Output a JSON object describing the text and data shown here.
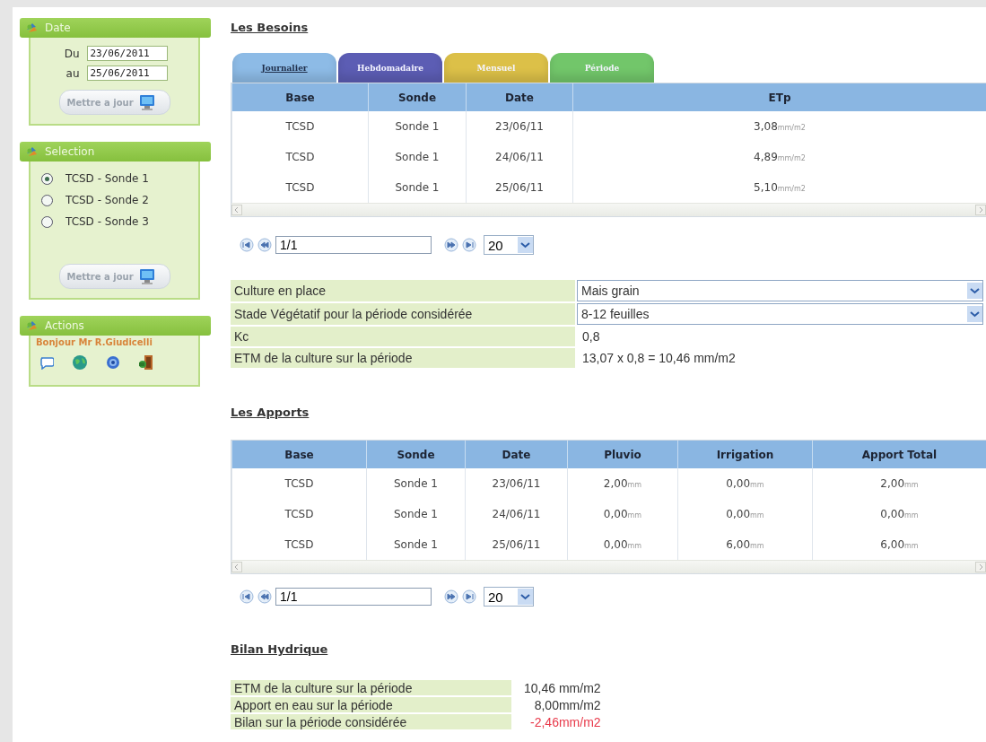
{
  "sidebar": {
    "panels": [
      {
        "kind": "dates",
        "title": "Date",
        "fields": [
          {
            "label": "Du",
            "value": "23/06/2011"
          },
          {
            "label": "au",
            "value": "25/06/2011"
          }
        ],
        "button": "Mettre a jour"
      },
      {
        "kind": "selection",
        "title": "Selection",
        "options": [
          {
            "label": "TCSD - Sonde 1",
            "selected": true
          },
          {
            "label": "TCSD - Sonde 2",
            "selected": false
          },
          {
            "label": "TCSD - Sonde 3",
            "selected": false
          }
        ],
        "button": "Mettre a jour"
      },
      {
        "kind": "actions",
        "title": "Actions",
        "greeting": "Bonjour Mr R.Giudicelli"
      }
    ]
  },
  "besoins": {
    "title": "Les Besoins",
    "tabs": [
      {
        "label": "Journalier",
        "selected": true,
        "color": "#8dbbe6"
      },
      {
        "label": "Hebdomadaire",
        "selected": false,
        "color": "#5c5db4"
      },
      {
        "label": "Mensuel",
        "selected": false,
        "color": "#dcc048"
      },
      {
        "label": "Période",
        "selected": false,
        "color": "#72c66a"
      }
    ],
    "table": {
      "columns": [
        "Base",
        "Sonde",
        "Date",
        "ETp"
      ],
      "rows": [
        [
          {
            "value": "TCSD"
          },
          {
            "value": "Sonde 1"
          },
          {
            "value": "23/06/11"
          },
          {
            "value": "3,08",
            "unit": "mm/m2"
          }
        ],
        [
          {
            "value": "TCSD"
          },
          {
            "value": "Sonde 1"
          },
          {
            "value": "24/06/11"
          },
          {
            "value": "4,89",
            "unit": "mm/m2"
          }
        ],
        [
          {
            "value": "TCSD"
          },
          {
            "value": "Sonde 1"
          },
          {
            "value": "25/06/11"
          },
          {
            "value": "5,10",
            "unit": "mm/m2"
          }
        ]
      ]
    },
    "pager": {
      "page": "1/1",
      "page_size": "20"
    },
    "form": [
      {
        "kind": "select",
        "label": "Culture en place",
        "value": "Mais grain"
      },
      {
        "kind": "select",
        "label": "Stade Végétatif pour la période considérée",
        "value": "8-12 feuilles"
      },
      {
        "kind": "text",
        "label": "Kc",
        "value": "0,8"
      },
      {
        "kind": "text",
        "label": "ETM de la culture sur la période",
        "value": "13,07 x 0,8 = 10,46 mm/m2"
      }
    ]
  },
  "apports": {
    "title": "Les Apports",
    "table": {
      "columns": [
        "Base",
        "Sonde",
        "Date",
        "Pluvio",
        "Irrigation",
        "Apport Total"
      ],
      "rows": [
        [
          {
            "value": "TCSD"
          },
          {
            "value": "Sonde 1"
          },
          {
            "value": "23/06/11"
          },
          {
            "value": "2,00",
            "unit": "mm"
          },
          {
            "value": "0,00",
            "unit": "mm"
          },
          {
            "value": "2,00",
            "unit": "mm"
          }
        ],
        [
          {
            "value": "TCSD"
          },
          {
            "value": "Sonde 1"
          },
          {
            "value": "24/06/11"
          },
          {
            "value": "0,00",
            "unit": "mm"
          },
          {
            "value": "0,00",
            "unit": "mm"
          },
          {
            "value": "0,00",
            "unit": "mm"
          }
        ],
        [
          {
            "value": "TCSD"
          },
          {
            "value": "Sonde 1"
          },
          {
            "value": "25/06/11"
          },
          {
            "value": "0,00",
            "unit": "mm"
          },
          {
            "value": "6,00",
            "unit": "mm"
          },
          {
            "value": "6,00",
            "unit": "mm"
          }
        ]
      ]
    },
    "pager": {
      "page": "1/1",
      "page_size": "20"
    }
  },
  "bilan": {
    "title": "Bilan Hydrique",
    "rows": [
      {
        "label": "ETM de la culture sur la période",
        "value": "10,46 mm/m2",
        "negative": false
      },
      {
        "label": "Apport en eau sur la période",
        "value": "8,00mm/m2",
        "negative": false
      },
      {
        "label": "Bilan sur la période considérée",
        "value": "-2,46mm/m2",
        "negative": true
      }
    ]
  }
}
